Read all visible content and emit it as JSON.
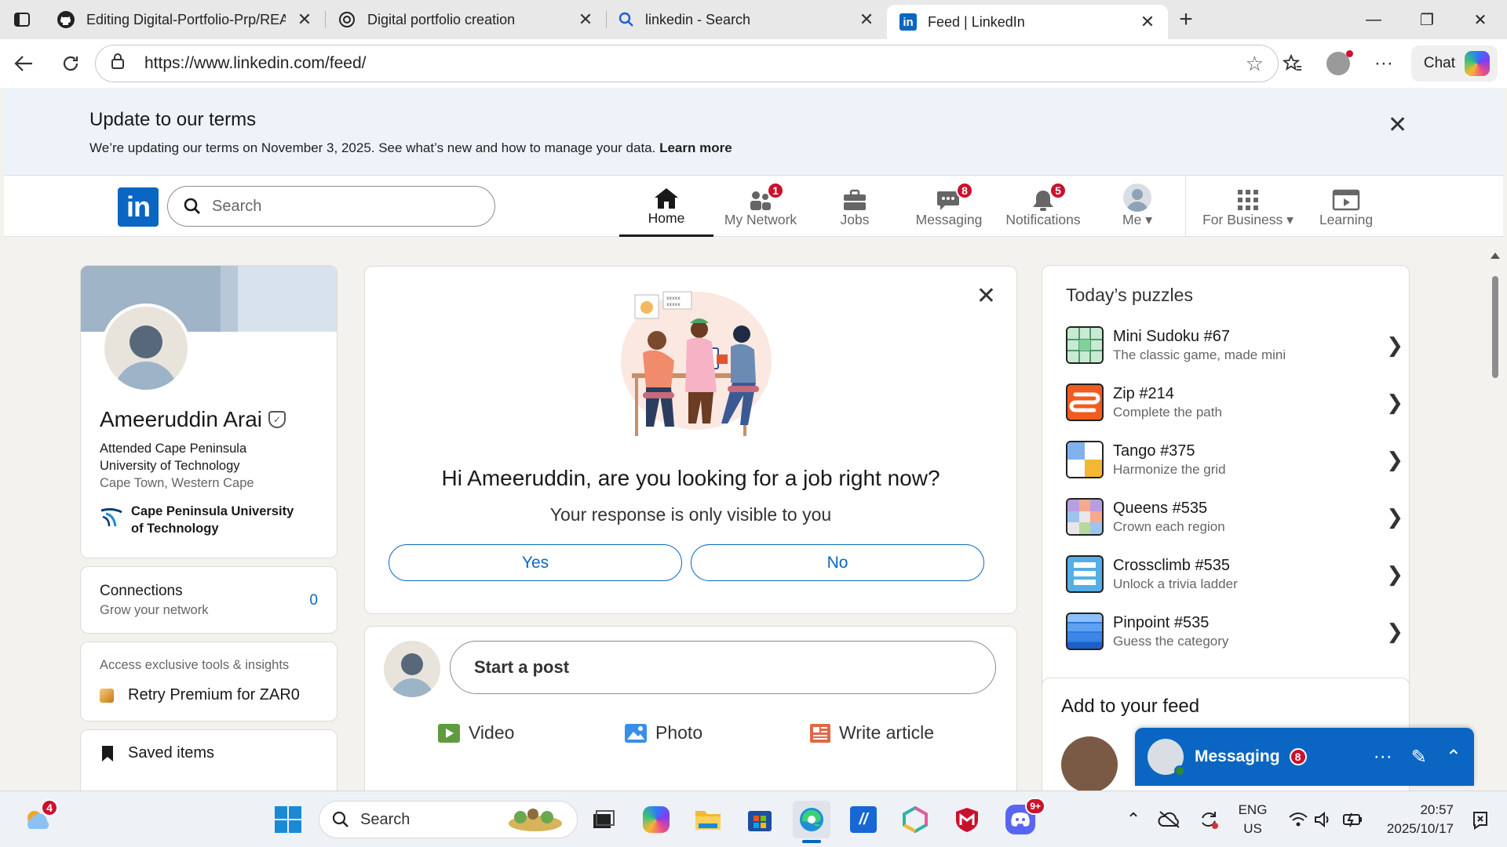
{
  "browser": {
    "tabs": [
      {
        "title": "Editing Digital-Portfolio-Prp/READ",
        "icon": "github-icon"
      },
      {
        "title": "Digital portfolio creation",
        "icon": "openai-icon"
      },
      {
        "title": "linkedin - Search",
        "icon": "search-icon"
      },
      {
        "title": "Feed | LinkedIn",
        "icon": "linkedin-icon",
        "active": true
      }
    ],
    "url": "https://www.linkedin.com/feed/",
    "chat_label": "Chat"
  },
  "terms_banner": {
    "title": "Update to our terms",
    "text": "We’re updating our terms on November 3, 2025. See what’s new and how to manage your data.",
    "link": "Learn more"
  },
  "linkedin_header": {
    "logo": "in",
    "search_placeholder": "Search",
    "nav": [
      {
        "label": "Home",
        "icon": "home-icon",
        "active": true
      },
      {
        "label": "My Network",
        "icon": "network-icon",
        "badge": "1"
      },
      {
        "label": "Jobs",
        "icon": "briefcase-icon"
      },
      {
        "label": "Messaging",
        "icon": "messaging-icon",
        "badge": "8"
      },
      {
        "label": "Notifications",
        "icon": "bell-icon",
        "badge": "5"
      },
      {
        "label": "Me",
        "icon": "avatar-icon"
      },
      {
        "label": "For Business",
        "icon": "grid-icon"
      },
      {
        "label": "Learning",
        "icon": "learning-icon"
      }
    ]
  },
  "profile": {
    "name": "Ameeruddin Arai",
    "headline": "Attended Cape Peninsula University of Technology",
    "location": "Cape Town, Western Cape",
    "organization": "Cape Peninsula University of Technology"
  },
  "connections": {
    "title": "Connections",
    "subtitle": "Grow your network",
    "count": "0"
  },
  "premium": {
    "subtitle": "Access exclusive tools & insights",
    "cta": "Retry Premium for ZAR0"
  },
  "saved": {
    "label": "Saved items"
  },
  "job_prompt": {
    "question": "Hi Ameeruddin, are you looking for a job right now?",
    "subtitle": "Your response is only visible to you",
    "yes": "Yes",
    "no": "No"
  },
  "start_post": {
    "placeholder": "Start a post",
    "actions": [
      {
        "label": "Video",
        "icon": "video-icon",
        "color": "#5f9b41"
      },
      {
        "label": "Photo",
        "icon": "photo-icon",
        "color": "#378fe9"
      },
      {
        "label": "Write article",
        "icon": "article-icon",
        "color": "#e06847"
      }
    ]
  },
  "puzzles": {
    "title": "Today’s puzzles",
    "items": [
      {
        "name": "Mini Sudoku",
        "number": "#67",
        "desc": "The classic game, made mini",
        "icon": "sudoku-icon"
      },
      {
        "name": "Zip",
        "number": "#214",
        "desc": "Complete the path",
        "icon": "zip-icon"
      },
      {
        "name": "Tango",
        "number": "#375",
        "desc": "Harmonize the grid",
        "icon": "tango-icon"
      },
      {
        "name": "Queens",
        "number": "#535",
        "desc": "Crown each region",
        "icon": "queens-icon"
      },
      {
        "name": "Crossclimb",
        "number": "#535",
        "desc": "Unlock a trivia ladder",
        "icon": "crossclimb-icon"
      },
      {
        "name": "Pinpoint",
        "number": "#535",
        "desc": "Guess the category",
        "icon": "pinpoint-icon"
      }
    ]
  },
  "add_feed": {
    "title": "Add to your feed"
  },
  "messaging": {
    "title": "Messaging",
    "badge": "8"
  },
  "taskbar": {
    "weather_badge": "4",
    "search_placeholder": "Search",
    "discord_badge": "9+",
    "lang_top": "ENG",
    "lang_bottom": "US",
    "time": "20:57",
    "date": "2025/10/17"
  },
  "colors": {
    "linkedin_blue": "#0a66c2",
    "badge_red": "#cb112d",
    "page_bg": "#f4f2ee"
  }
}
